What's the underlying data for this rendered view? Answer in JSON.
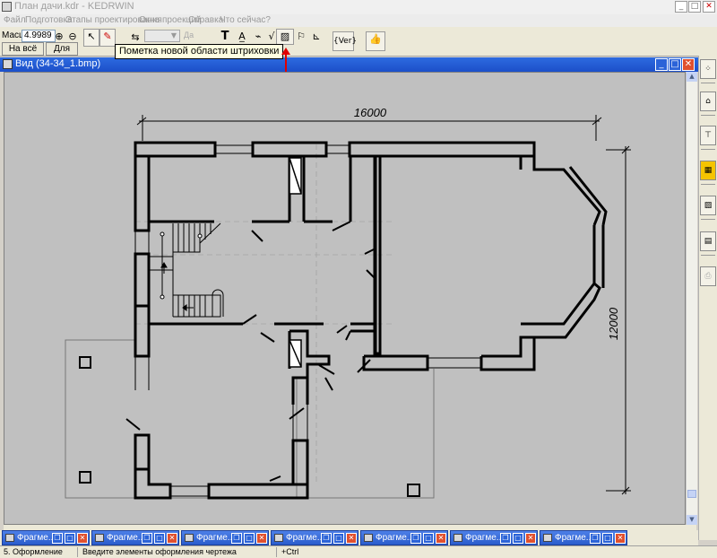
{
  "window": {
    "title": "План дачи.kdr - KEDRWIN"
  },
  "menu": [
    "Файл",
    "Подготовка",
    "Этапы проектирования",
    "Окна проекций",
    "Справка",
    "Что сейчас?"
  ],
  "toolbar": {
    "scale_label": "Масшт",
    "scale_value": "4.9989",
    "fit_window_label": "На всё окно",
    "for_all_label": "Для всех",
    "disabled_label": "Да",
    "text_tool": "T",
    "ver_label": "{Ver}",
    "tooltip": "Пометка новой области штриховки"
  },
  "document": {
    "title": "Вид (34-34_1.bmp)",
    "colors": {
      "wall": "#000000",
      "canvas": "#c0c0c0",
      "thin_line": "#777777"
    }
  },
  "drawing": {
    "dim_horizontal": "16000",
    "dim_vertical": "12000"
  },
  "fragments": [
    "Фрагме...",
    "Фрагме...",
    "Фрагме...",
    "Фрагме...",
    "Фрагме...",
    "Фрагме...",
    "Фрагме..."
  ],
  "status": {
    "stage": "5. Оформление",
    "hint": "Введите элементы оформления чертежа",
    "modifier": "+Ctrl"
  }
}
